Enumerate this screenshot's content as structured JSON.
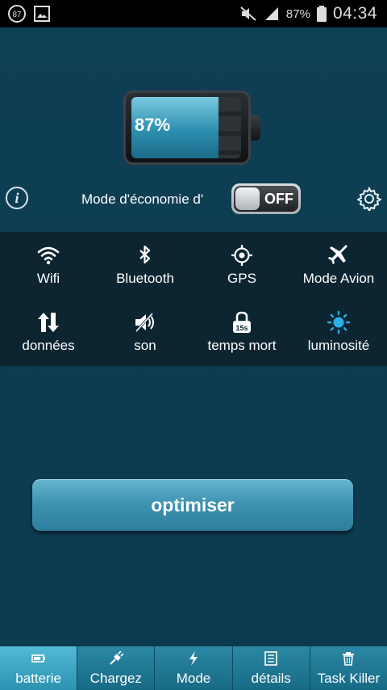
{
  "status_bar": {
    "notification_badge": "87",
    "battery_percent": "87%",
    "time": "04:34"
  },
  "battery": {
    "level_text": "87%",
    "level": 0.87
  },
  "power_saving": {
    "label": "Mode d'économie d'",
    "toggle_state": "OFF"
  },
  "toggles": [
    {
      "label": "Wifi",
      "icon": "wifi-icon"
    },
    {
      "label": "Bluetooth",
      "icon": "bluetooth-icon"
    },
    {
      "label": "GPS",
      "icon": "gps-icon"
    },
    {
      "label": "Mode Avion",
      "icon": "airplane-icon"
    },
    {
      "label": "données",
      "icon": "data-arrows-icon"
    },
    {
      "label": "son",
      "icon": "speaker-icon"
    },
    {
      "label": "temps mort",
      "icon": "timeout-lock-icon",
      "badge": "15s"
    },
    {
      "label": "luminosité",
      "icon": "brightness-icon"
    }
  ],
  "optimise_label": "optimiser",
  "tabs": [
    {
      "label": "batterie",
      "icon": "battery-icon",
      "active": true
    },
    {
      "label": "Chargez",
      "icon": "plug-icon"
    },
    {
      "label": "Mode",
      "icon": "bolt-icon"
    },
    {
      "label": "détails",
      "icon": "list-icon"
    },
    {
      "label": "Task Killer",
      "icon": "trash-icon"
    }
  ],
  "colors": {
    "background": "#0f3f54",
    "accent": "#3f94b2",
    "brightness_icon": "#2ab0e8"
  }
}
